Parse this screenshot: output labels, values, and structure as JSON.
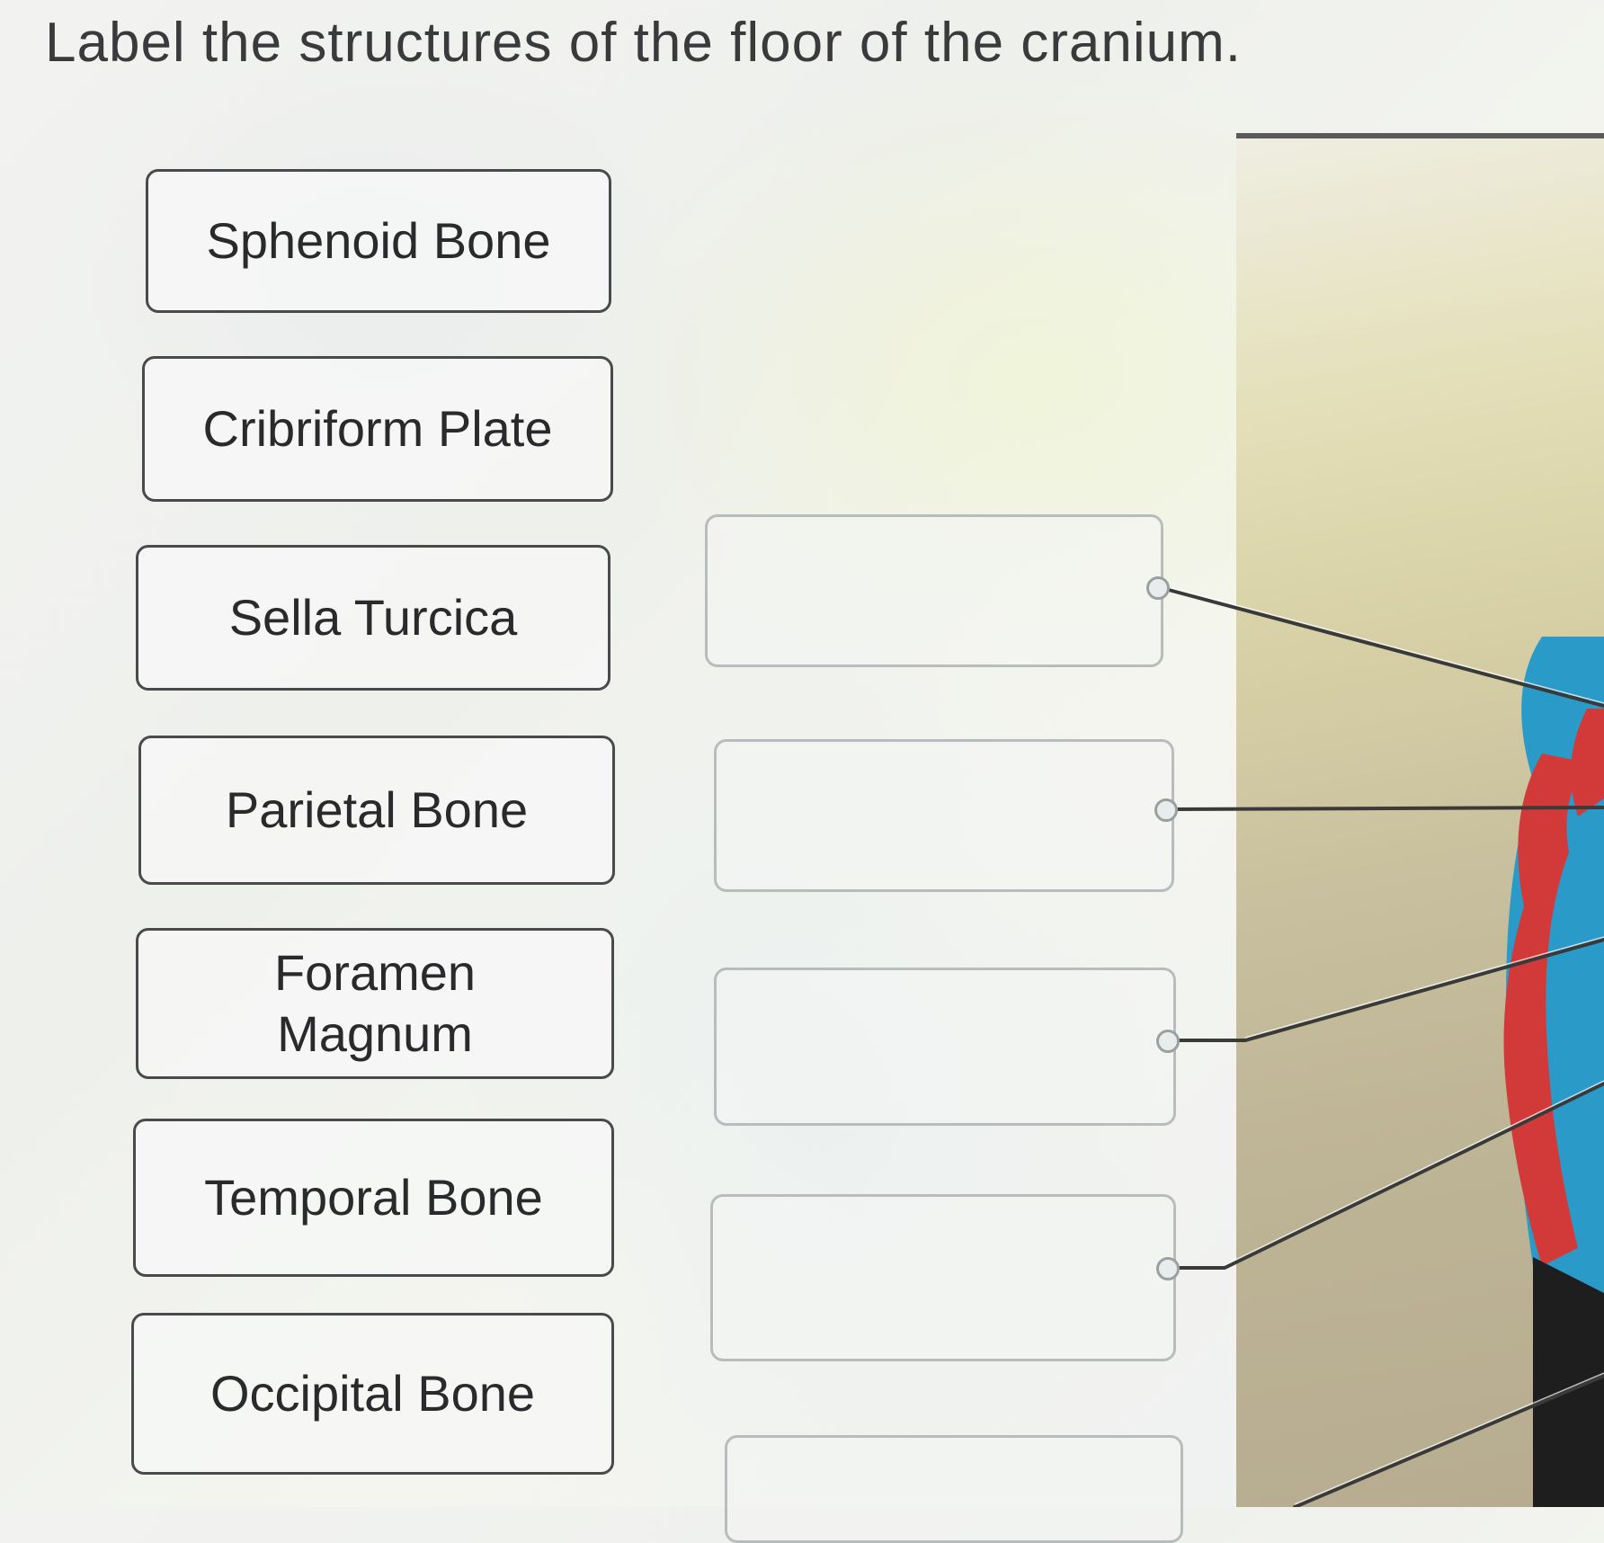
{
  "question": {
    "title": "Label the structures of the floor of the cranium."
  },
  "label_bank": [
    {
      "id": "sphenoid",
      "text": "Sphenoid Bone"
    },
    {
      "id": "cribriform",
      "text": "Cribriform Plate"
    },
    {
      "id": "sella",
      "text": "Sella Turcica"
    },
    {
      "id": "parietal",
      "text": "Parietal Bone"
    },
    {
      "id": "foramen",
      "text": "Foramen\nMagnum"
    },
    {
      "id": "temporal",
      "text": "Temporal Bone"
    },
    {
      "id": "occipital",
      "text": "Occipital Bone"
    }
  ],
  "drop_targets": [
    {
      "id": "target-1",
      "value": ""
    },
    {
      "id": "target-2",
      "value": ""
    },
    {
      "id": "target-3",
      "value": ""
    },
    {
      "id": "target-4",
      "value": ""
    },
    {
      "id": "target-5",
      "value": ""
    }
  ],
  "colors": {
    "tile_border": "#4a4a4c",
    "target_border": "#b9bcbc",
    "text": "#2a2a2c",
    "model_red": "#d23a3a",
    "model_blue": "#2a9bc9",
    "leader_line": "#3a3a3a"
  }
}
